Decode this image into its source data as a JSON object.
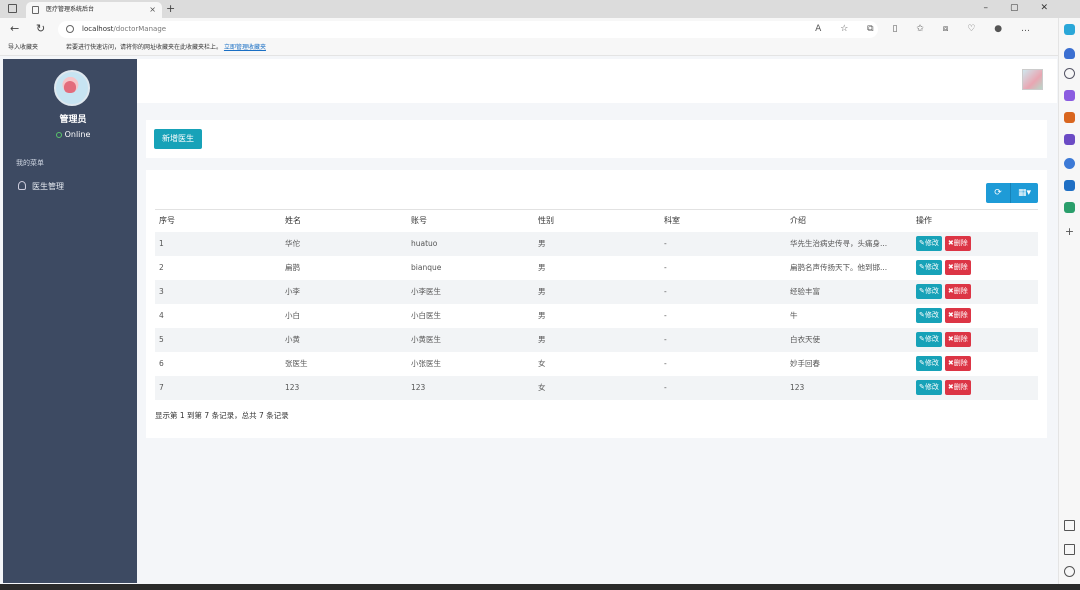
{
  "browser": {
    "tab_title": "医疗管理系统后台",
    "tab_close": "×",
    "new_tab": "+",
    "url_host": "localhost",
    "url_path": "/doctorManage",
    "import_favorites": "导入收藏夹",
    "fav_tip": "若要进行快速访问，请将你的网址收藏夹在此收藏夹栏上。",
    "fav_tip_link": "立即管理收藏夹"
  },
  "sidebar": {
    "admin_name": "管理员",
    "status": "Online",
    "menu_header": "我的菜单",
    "items": [
      {
        "label": "医生管理",
        "icon": "user-icon"
      }
    ]
  },
  "toolbar": {
    "add_label": "新增医生"
  },
  "table": {
    "columns": [
      "序号",
      "姓名",
      "账号",
      "性别",
      "科室",
      "介绍",
      "操作"
    ],
    "edit_label": "修改",
    "delete_label": "删除",
    "rows": [
      [
        "1",
        "华佗",
        "huatuo",
        "男",
        "-",
        "华先生治病史传寻，头痛身..."
      ],
      [
        "2",
        "扁鹊",
        "bianque",
        "男",
        "-",
        "扁鹊名声传扬天下。他到邯..."
      ],
      [
        "3",
        "小李",
        "小李医生",
        "男",
        "-",
        "经验丰富"
      ],
      [
        "4",
        "小白",
        "小白医生",
        "男",
        "-",
        "牛"
      ],
      [
        "5",
        "小黄",
        "小黄医生",
        "男",
        "-",
        "白衣天使"
      ],
      [
        "6",
        "张医生",
        "小张医生",
        "女",
        "-",
        "妙手回春"
      ],
      [
        "7",
        "123",
        "123",
        "女",
        "-",
        "123"
      ]
    ],
    "summary": "显示第 1 到第 7 条记录，总共 7 条记录"
  },
  "colors": {
    "sidebar_bg": "#3d4a62",
    "primary": "#17a2b8",
    "danger": "#dc3545",
    "tool": "#1e9bd7"
  }
}
